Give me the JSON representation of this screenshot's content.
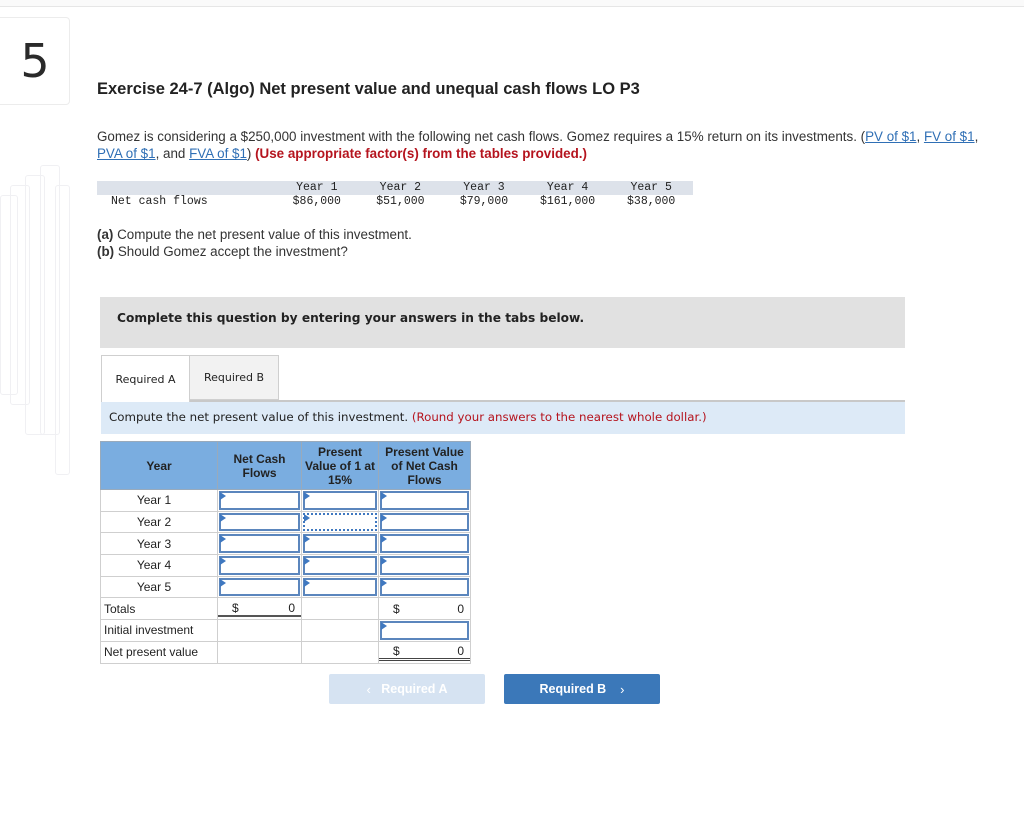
{
  "question_number": "5",
  "title": "Exercise 24-7 (Algo) Net present value and unequal cash flows LO P3",
  "intro": {
    "text": "Gomez is considering a $250,000 investment with the following net cash flows. Gomez requires a 15% return on its investments. (",
    "links": [
      "PV of $1",
      "FV of $1",
      "PVA of $1",
      "FVA of $1"
    ],
    "sep1": ", ",
    "sep2": ", ",
    "sep3": ", and ",
    "close": ") ",
    "instruction": "(Use appropriate factor(s) from the tables provided.)"
  },
  "cash_flows": {
    "row_label": "Net cash flows",
    "years": [
      "Year 1",
      "Year 2",
      "Year 3",
      "Year 4",
      "Year 5"
    ],
    "values": [
      "$86,000",
      "$51,000",
      "$79,000",
      "$161,000",
      "$38,000"
    ]
  },
  "questions": [
    {
      "tag": "(a)",
      "text": " Compute the net present value of this investment."
    },
    {
      "tag": "(b)",
      "text": " Should Gomez accept the investment?"
    }
  ],
  "banner": "Complete this question by entering your answers in the tabs below.",
  "tabs": [
    {
      "label": "Required A",
      "active": true
    },
    {
      "label": "Required B",
      "active": false
    }
  ],
  "instruction": {
    "text": "Compute the net present value of this investment. ",
    "note": "(Round your answers to the nearest whole dollar.)"
  },
  "worksheet": {
    "headers": [
      "Year",
      "Net Cash Flows",
      "Present Value of 1 at 15%",
      "Present Value of Net Cash Flows"
    ],
    "year_rows": [
      "Year 1",
      "Year 2",
      "Year 3",
      "Year 4",
      "Year 5"
    ],
    "totals": {
      "label": "Totals",
      "currency": "$",
      "net_cash_flows": "0",
      "pv_net_cash_flows": "0"
    },
    "initial_investment": {
      "label": "Initial investment"
    },
    "npv": {
      "label": "Net present value",
      "currency": "$",
      "value": "0"
    }
  },
  "nav": {
    "prev_label": "Required A",
    "next_label": "Required B",
    "prev_icon": "‹",
    "next_icon": "›"
  },
  "colors": {
    "link": "#2f6fb5",
    "alert_red": "#b5141e",
    "header_blue": "#7aade0",
    "nav_blue": "#3b78b9"
  }
}
